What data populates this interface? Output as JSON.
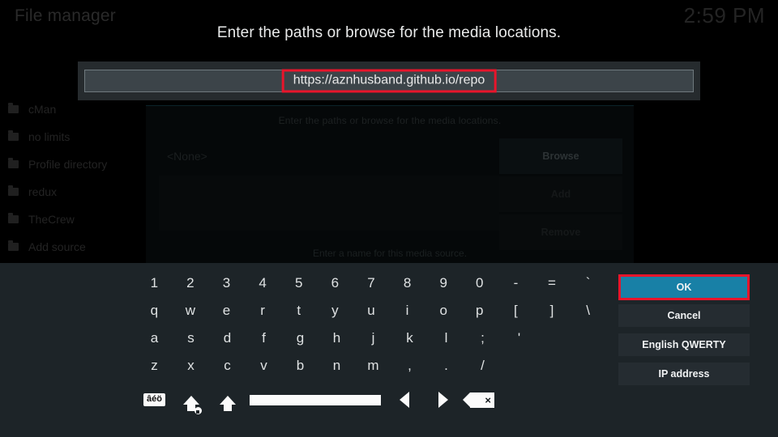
{
  "window": {
    "title": "File manager",
    "clock": "2:59 PM"
  },
  "sidebar": {
    "items": [
      {
        "label": "cMan",
        "icon": "folder-icon"
      },
      {
        "label": "no limits",
        "icon": "folder-icon"
      },
      {
        "label": "Profile directory",
        "icon": "folder-icon"
      },
      {
        "label": "redux",
        "icon": "folder-icon"
      },
      {
        "label": "TheCrew",
        "icon": "folder-icon"
      },
      {
        "label": "Add source",
        "icon": "folder-icon"
      }
    ]
  },
  "prompt": "Enter the paths or browse for the media locations.",
  "entry": {
    "value": "https://aznhusband.github.io/repo",
    "highlight_color": "#e8152b"
  },
  "dialog": {
    "heading": "Enter the paths or browse for the media locations.",
    "path_value": "<None>",
    "buttons": [
      "Browse",
      "Add",
      "Remove"
    ],
    "footer": "Enter a name for this media source."
  },
  "keyboard": {
    "rows": [
      [
        "1",
        "2",
        "3",
        "4",
        "5",
        "6",
        "7",
        "8",
        "9",
        "0",
        "-",
        "=",
        "`"
      ],
      [
        "q",
        "w",
        "e",
        "r",
        "t",
        "y",
        "u",
        "i",
        "o",
        "p",
        "[",
        "]",
        "\\"
      ],
      [
        "a",
        "s",
        "d",
        "f",
        "g",
        "h",
        "j",
        "k",
        "l",
        ";",
        "'"
      ],
      [
        "z",
        "x",
        "c",
        "v",
        "b",
        "n",
        "m",
        ",",
        ".",
        "/"
      ]
    ],
    "function_row": [
      {
        "name": "symbols-key",
        "label": "âéö"
      },
      {
        "name": "caps-lock-key",
        "label": ""
      },
      {
        "name": "shift-key",
        "label": ""
      },
      {
        "name": "space-key",
        "label": ""
      },
      {
        "name": "cursor-left-key",
        "label": ""
      },
      {
        "name": "cursor-right-key",
        "label": ""
      },
      {
        "name": "backspace-key",
        "label": "×"
      }
    ],
    "actions": [
      {
        "label": "OK",
        "selected": true,
        "color": "#1880a6"
      },
      {
        "label": "Cancel",
        "selected": false
      },
      {
        "label": "English QWERTY",
        "selected": false
      },
      {
        "label": "IP address",
        "selected": false
      }
    ]
  }
}
